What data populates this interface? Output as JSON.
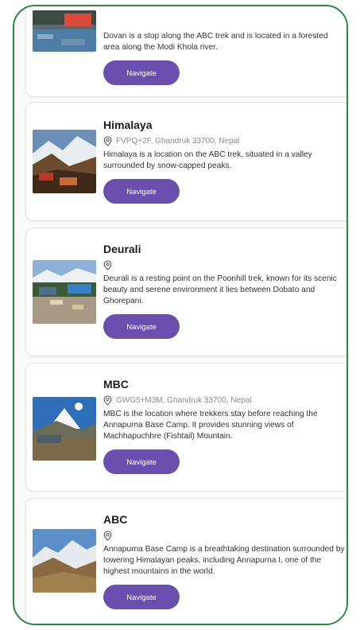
{
  "colors": {
    "accent": "#6a4fae",
    "frame": "#2e8540"
  },
  "icons": {
    "location": "location-pin-icon"
  },
  "places": [
    {
      "title": "",
      "location": "",
      "description": "Dovan is a stop along the ABC trek and is located in a forested area along the Modi Khola river.",
      "button": "Navigate"
    },
    {
      "title": "Himalaya",
      "location": "FVPQ+2F, Ghandruk 33700, Nepal",
      "description": "Himalaya is a location on the ABC trek, situated in a valley surrounded by snow-capped peaks.",
      "button": "Navigate"
    },
    {
      "title": "Deurali",
      "location": "",
      "description": "Deurali is a resting point on the Poonhill trek, known for its scenic beauty and serene environment it lies between Dobato and Ghorepani.",
      "button": "Navigate"
    },
    {
      "title": "MBC",
      "location": "GWG5+M3M, Ghandruk 33700, Nepal",
      "description": "MBC is the location where trekkers stay before reaching the Annapurna Base Camp. It provides stunning views of Machhapuchhre (Fishtail) Mountain.",
      "button": "Navigate"
    },
    {
      "title": "ABC",
      "location": "",
      "description": "Annapurna Base Camp is a breathtaking destination surrounded by towering Himalayan peaks, including Annapurna I, one of the highest mountains in the world.",
      "button": "Navigate"
    }
  ]
}
